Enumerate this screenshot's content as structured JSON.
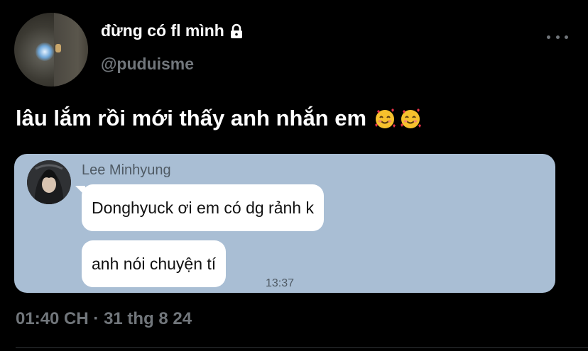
{
  "tweet": {
    "display_name": "đừng có fl mình",
    "handle": "@puduisme",
    "text": "lâu lắm rồi mới thấy anh nhắn em",
    "emojis": [
      "smiling-face-with-hearts-icon",
      "smiling-face-with-hearts-icon"
    ],
    "timestamp": "01:40 CH",
    "separator": "·",
    "date": "31 thg 8 24"
  },
  "chat": {
    "sender": "Lee Minhyung",
    "messages": [
      "Donghyuck ơi em có dg rảnh k",
      "anh nói chuyện tí"
    ],
    "time": "13:37"
  },
  "colors": {
    "background": "#000000",
    "text": "#ffffff",
    "muted": "#71767b",
    "chat_background": "#a9bed4",
    "bubble": "#ffffff"
  }
}
